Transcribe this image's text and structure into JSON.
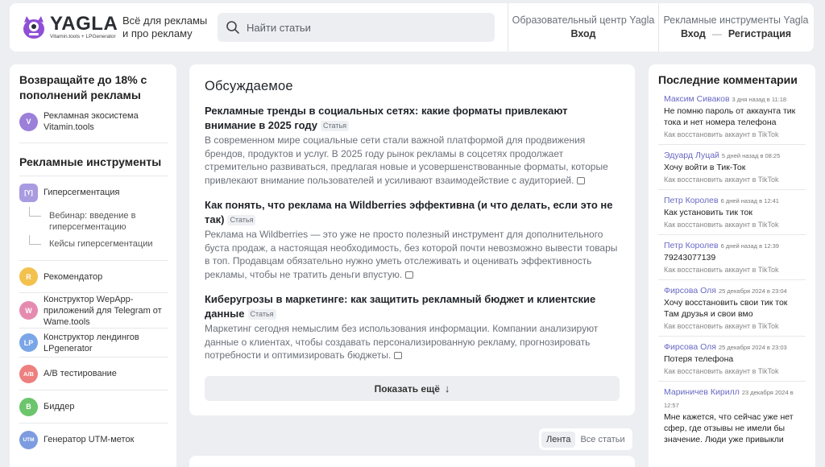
{
  "header": {
    "logo_name": "YAGLA",
    "logo_sub": "Vitamin.tools + LPGenerator",
    "tagline": "Всё для рекламы и про рекламу",
    "search_placeholder": "Найти статьи",
    "edu_title": "Образовательный центр Yagla",
    "edu_login": "Вход",
    "tools_title": "Рекламные инструменты Yagla",
    "tools_login": "Вход",
    "tools_sep": "—",
    "tools_register": "Регистрация"
  },
  "left": {
    "promo": "Возвращайте до 18% с пополнений рекламы",
    "eco": {
      "icon": "V",
      "label": "Рекламная экосистема Vitamin.tools",
      "color": "#9b7fd9"
    },
    "tools_heading": "Рекламные инструменты",
    "hyperseg": {
      "icon": "[Y]",
      "label": "Гиперсегментация",
      "color": "#a99be0"
    },
    "subitems": [
      "Вебинар: введение в гиперсегментацию",
      "Кейсы гиперсегментации"
    ],
    "tools": [
      {
        "icon": "R",
        "label": "Рекомендатор",
        "color": "#f2c14e"
      },
      {
        "icon": "W",
        "label": "Конструктор WepApp-приложений для Telegram от Wame.tools",
        "color": "#e58bb0"
      },
      {
        "icon": "LP",
        "label": "Конструктор лендингов LPgenerator",
        "color": "#7aa6e8"
      },
      {
        "icon": "A/B",
        "label": "A/B тестирование",
        "color": "#ee7f7f"
      },
      {
        "icon": "B",
        "label": "Биддер",
        "color": "#6cc56c"
      },
      {
        "icon": "UTM",
        "label": "Генератор UTM-меток",
        "color": "#7d9ce0"
      }
    ]
  },
  "center": {
    "heading": "Обсуждаемое",
    "badge": "Статья",
    "articles": [
      {
        "title": "Рекламные тренды в социальных сетях: какие форматы привлекают внимание в 2025 году",
        "text": "В современном мире социальные сети стали важной платформой для продвижения брендов, продуктов и услуг. В 2025 году рынок рекламы в соцсетях продолжает стремительно развиваться, предлагая новые и усовершенствованные форматы, которые привлекают внимание пользователей и усиливают взаимодействие с аудиторией."
      },
      {
        "title": "Как понять, что реклама на Wildberries эффективна (и что делать, если это не так)",
        "text": "Реклама на Wildberries — это уже не просто полезный инструмент для дополнительного буста продаж, а настоящая необходимость, без которой почти невозможно вывести товары в топ. Продавцам обязательно нужно уметь отслеживать и оценивать эффективность рекламы, чтобы не тратить деньги впустую."
      },
      {
        "title": "Киберугрозы в маркетинге: как защитить рекламный бюджет и клиентские данные",
        "text": "Маркетинг сегодня немыслим без использования информации. Компании анализируют данные о клиентах, чтобы создавать персонализированную рекламу, прогнозировать потребности и оптимизировать бюджеты."
      }
    ],
    "show_more": "Показать ещё",
    "feed_tabs": [
      "Лента",
      "Все статьи"
    ]
  },
  "right": {
    "heading": "Последние комментарии",
    "comments": [
      {
        "author": "Максим Сиваков",
        "time": "3 дня назад в 11:18",
        "text": "Не помню пароль от аккаунта тик тока и нет номера телефона",
        "topic": "Как восстановить аккаунт в TikTok"
      },
      {
        "author": "Эдуард Луцай",
        "time": "5 дней назад в 08:25",
        "text": "Хочу войти в Тик-Ток",
        "topic": "Как восстановить аккаунт в TikTok"
      },
      {
        "author": "Петр Королев",
        "time": "6 дней назад в 12:41",
        "text": "Как установить тик ток",
        "topic": "Как восстановить аккаунт в TikTok"
      },
      {
        "author": "Петр Королев",
        "time": "6 дней назад в 12:39",
        "text": "79243077139",
        "topic": "Как восстановить аккаунт в TikTok"
      },
      {
        "author": "Фирсова Оля",
        "time": "25 декабря 2024 в 23:04",
        "text": "Хочу восстановить свои тик ток Там друзья и свои вмо",
        "topic": "Как восстановить аккаунт в TikTok"
      },
      {
        "author": "Фирсова Оля",
        "time": "25 декабря 2024 в 23:03",
        "text": "Потеря телефона",
        "topic": "Как восстановить аккаунт в TikTok"
      },
      {
        "author": "Мариничев Кирилл",
        "time": "23 декабря 2024 в 12:57",
        "text": "Мне кажется, что сейчас уже нет сфер, где отзывы не имели бы значение. Люди уже привыкли",
        "topic": ""
      }
    ]
  }
}
